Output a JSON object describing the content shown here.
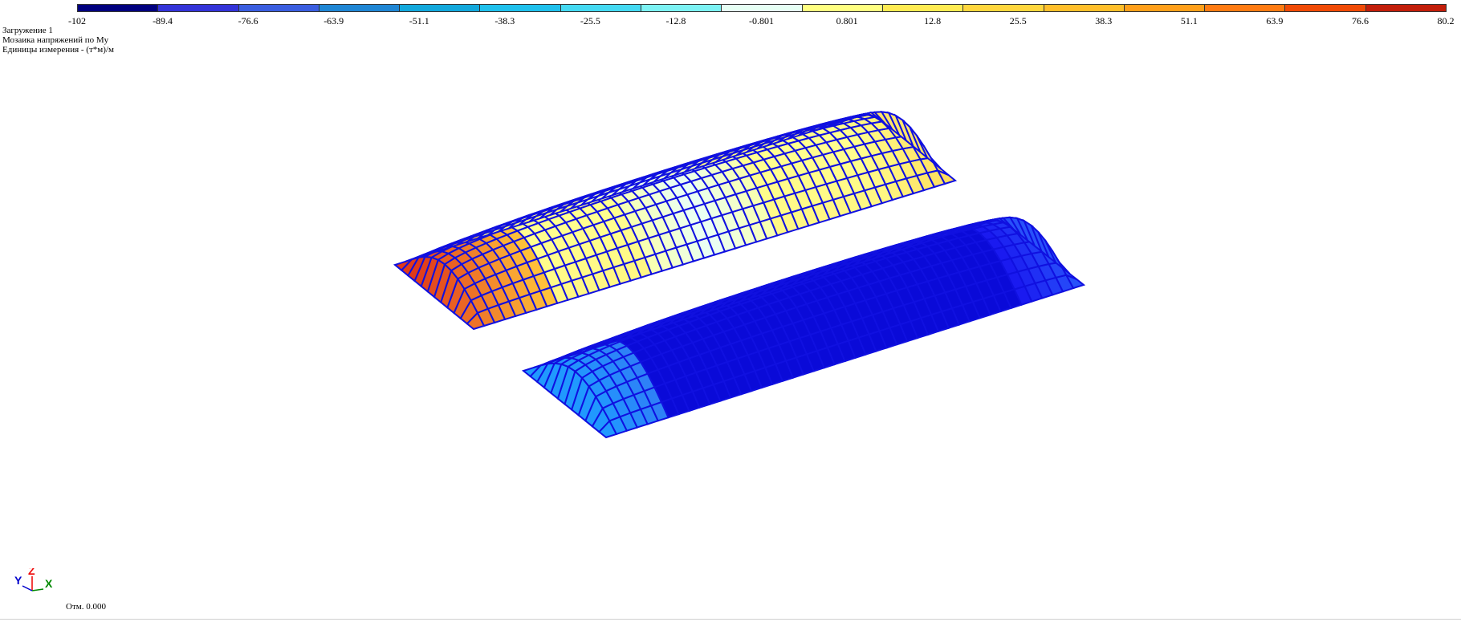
{
  "legend": {
    "colors": [
      "#00007f",
      "#3333d8",
      "#3a5ee0",
      "#1f86d4",
      "#12a8dc",
      "#1fc0ec",
      "#44d9f2",
      "#7cf2f4",
      "#e6fff4",
      "#ffff80",
      "#ffeb52",
      "#ffd63d",
      "#ffbe2a",
      "#ff9f1a",
      "#ff7b12",
      "#f04a06",
      "#c21e0a"
    ],
    "ticks": [
      "-102",
      "-89.4",
      "-76.6",
      "-63.9",
      "-51.1",
      "-38.3",
      "-25.5",
      "-12.8",
      "-0.801",
      "0.801",
      "12.8",
      "25.5",
      "38.3",
      "51.1",
      "63.9",
      "76.6",
      "80.2"
    ]
  },
  "info": {
    "load_case": "Загружение 1",
    "mosaic": "Мозаика напряжений по My",
    "units": "Единицы измерения - (т*м)/м"
  },
  "axes": {
    "y": "Y",
    "z": "Z",
    "x": "X"
  },
  "elevation": "Отм. 0.000",
  "colors": {
    "mesh_line": "#1010e0",
    "shell_a_low": "#ffff90",
    "shell_a_high": "#e03a1a",
    "shell_b_base": "#0a0ad8",
    "shell_b_edge": "#1f9bff"
  }
}
